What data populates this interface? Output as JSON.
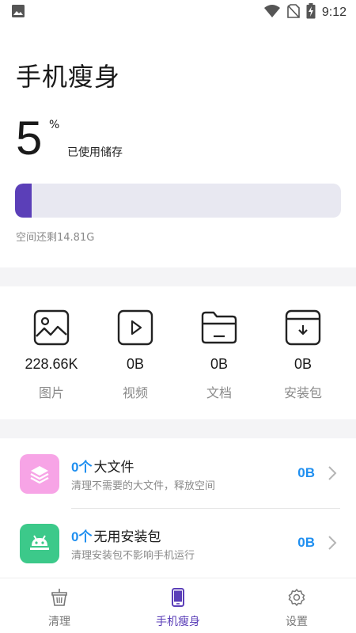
{
  "status_bar": {
    "time": "9:12",
    "icons": [
      "image-icon",
      "wifi-icon",
      "no-sim-icon",
      "battery-charging-icon"
    ]
  },
  "header": {
    "title": "手机瘦身"
  },
  "storage": {
    "used_percent": "5",
    "percent_sign": "%",
    "used_label": "已使用储存",
    "used_fraction": 0.05,
    "remaining_text": "空间还剩14.81G"
  },
  "categories": [
    {
      "icon": "picture-icon",
      "value": "228.66K",
      "label": "图片"
    },
    {
      "icon": "video-icon",
      "value": "0B",
      "label": "视频"
    },
    {
      "icon": "folder-icon",
      "value": "0B",
      "label": "文档"
    },
    {
      "icon": "install-package-icon",
      "value": "0B",
      "label": "安装包"
    }
  ],
  "list": [
    {
      "icon": "layers-icon",
      "count": "0个",
      "title": "大文件",
      "desc": "清理不需要的大文件，释放空间",
      "size": "0B"
    },
    {
      "icon": "android-icon",
      "count": "0个",
      "title": "无用安装包",
      "desc": "清理安装包不影响手机运行",
      "size": "0B"
    }
  ],
  "bottom_nav": [
    {
      "icon": "basket-icon",
      "label": "清理",
      "active": false
    },
    {
      "icon": "phone-icon",
      "label": "手机瘦身",
      "active": true
    },
    {
      "icon": "gear-icon",
      "label": "设置",
      "active": false
    }
  ],
  "colors": {
    "accent": "#5b3fb8",
    "link_blue": "#1f8ff0",
    "track": "#e8e8f1",
    "layers_icon_bg": "#f7a4e6",
    "android_icon_bg": "#3cc98a"
  }
}
